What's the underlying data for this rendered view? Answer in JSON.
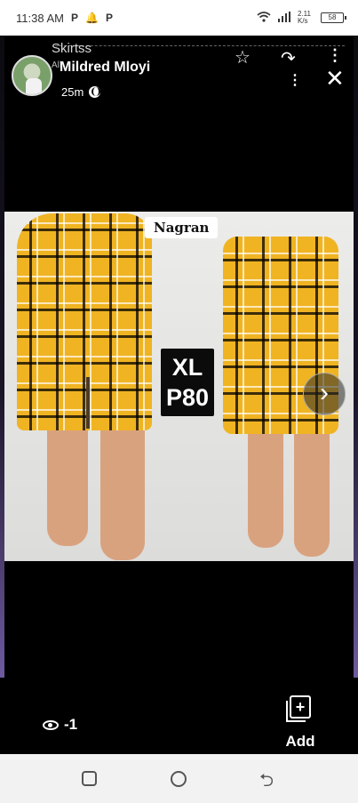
{
  "status_bar": {
    "time": "11:38 AM",
    "left_icons": [
      "P",
      "🔔",
      "P"
    ],
    "signal_text": "2.11 K/s",
    "battery": "58"
  },
  "header": {
    "background_title": "Skirtss",
    "background_subtitle": "All",
    "poster_name": "Mildred Mloyi",
    "time_ago": "25m",
    "star_icon": "☆",
    "share_icon": "↷",
    "more_icon": "⋮",
    "dots_icon": "⋮",
    "close_icon": "✕"
  },
  "photo": {
    "brand_text": "Nagran",
    "size_line1": "XL",
    "size_line2": "P80",
    "next_icon": "›"
  },
  "bottom": {
    "views_count": "-1",
    "add_label": "Add",
    "add_icon": "+"
  },
  "nav": {
    "back_icon": "⮌"
  },
  "colors": {
    "plaid_yellow": "#f0b422",
    "frame_purple": "#6d5aa0"
  }
}
